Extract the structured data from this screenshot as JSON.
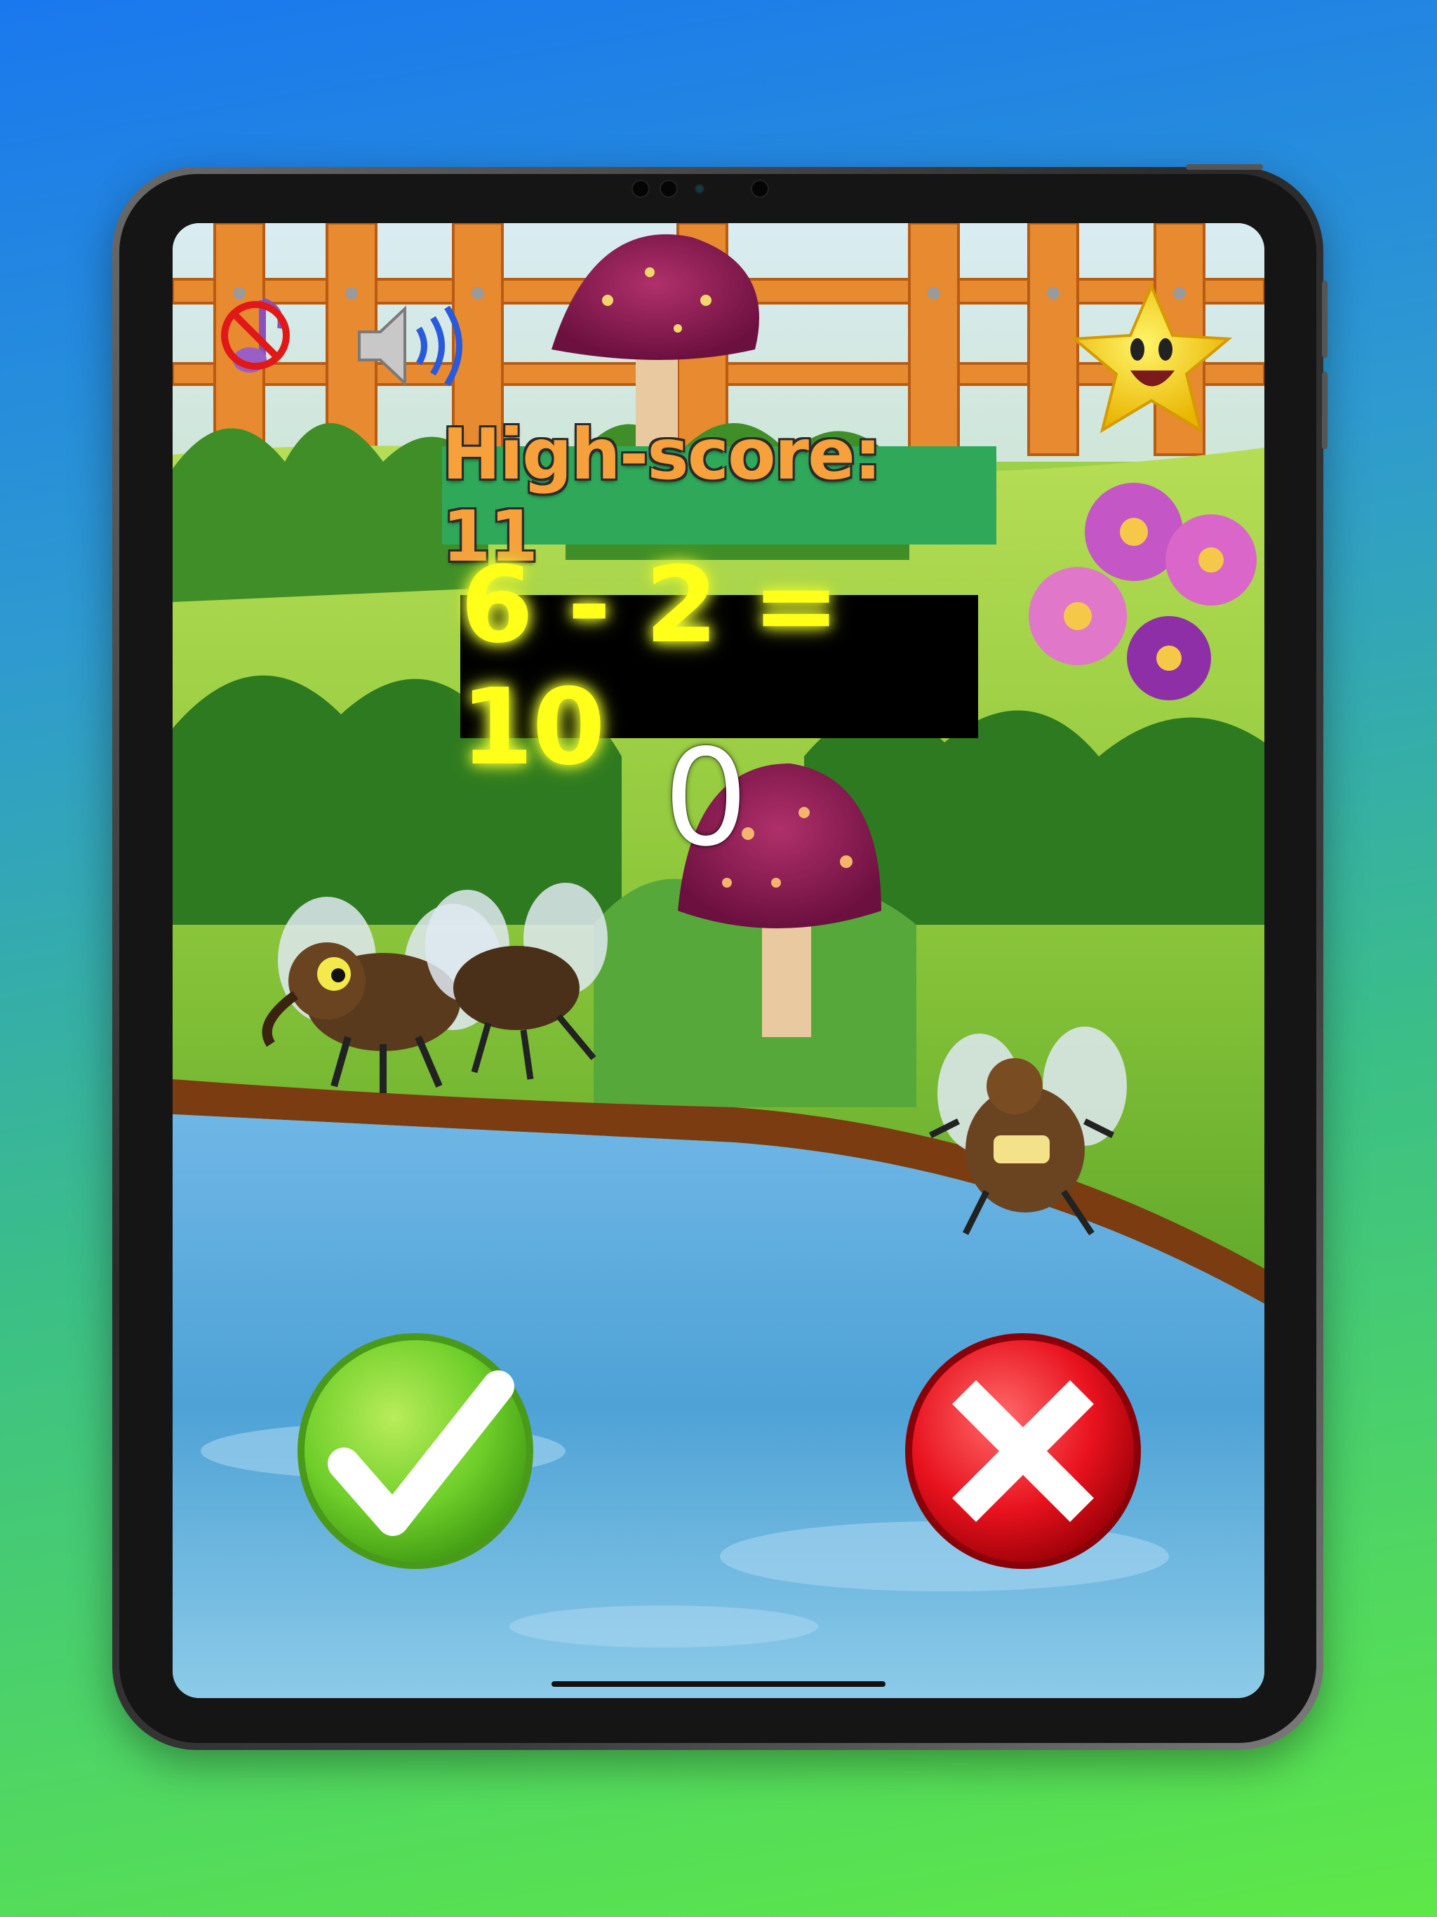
{
  "game": {
    "high_score_label": "High-score: 11",
    "equation": "6 - 2 = 10",
    "score": "0"
  },
  "controls": {
    "music_toggle": "music-off-icon",
    "sound_toggle": "speaker-on-icon",
    "mascot": "star-mascot-icon",
    "correct_button": "check-icon",
    "wrong_button": "cross-icon"
  },
  "colors": {
    "high_score_text": "#f6a13c",
    "high_score_bg": "#2fa85a",
    "equation_text": "#ffff1a",
    "equation_bg": "#000000",
    "correct_button": "#6fcf2a",
    "wrong_button": "#e8121e"
  }
}
